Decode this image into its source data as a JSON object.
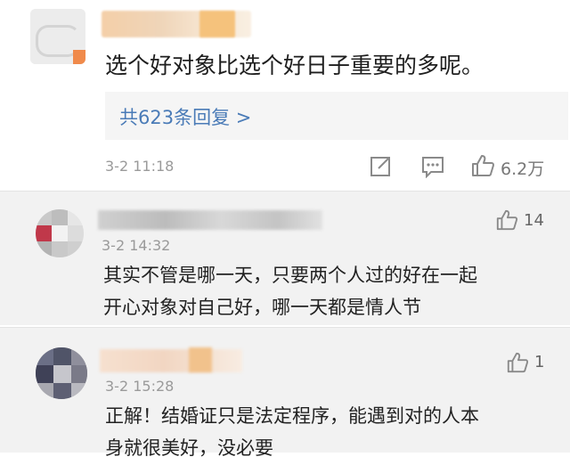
{
  "main_comment": {
    "text": "选个好对象比选个好日子重要的多呢。",
    "replies_link": "共623条回复 >",
    "time": "3-2 11:18",
    "likes": "6.2万",
    "icons": [
      "share-icon",
      "comment-icon",
      "like-icon"
    ]
  },
  "replies": [
    {
      "time": "3-2 14:32",
      "likes": "14",
      "lines": [
        "其实不管是哪一天，只要两个人过的好在一起",
        "开心对象对自己好，哪一天都是情人节"
      ]
    },
    {
      "time": "3-2 15:28",
      "likes": "1",
      "lines": [
        "正解！结婚证只是法定程序，能遇到对的人本",
        "身就很美好，没必要"
      ]
    }
  ],
  "colors": {
    "link": "#4a7bb7",
    "reply_box": "#f5f5f5",
    "sub_bg": "#f2f2f2",
    "meta": "#9a9a9a"
  }
}
